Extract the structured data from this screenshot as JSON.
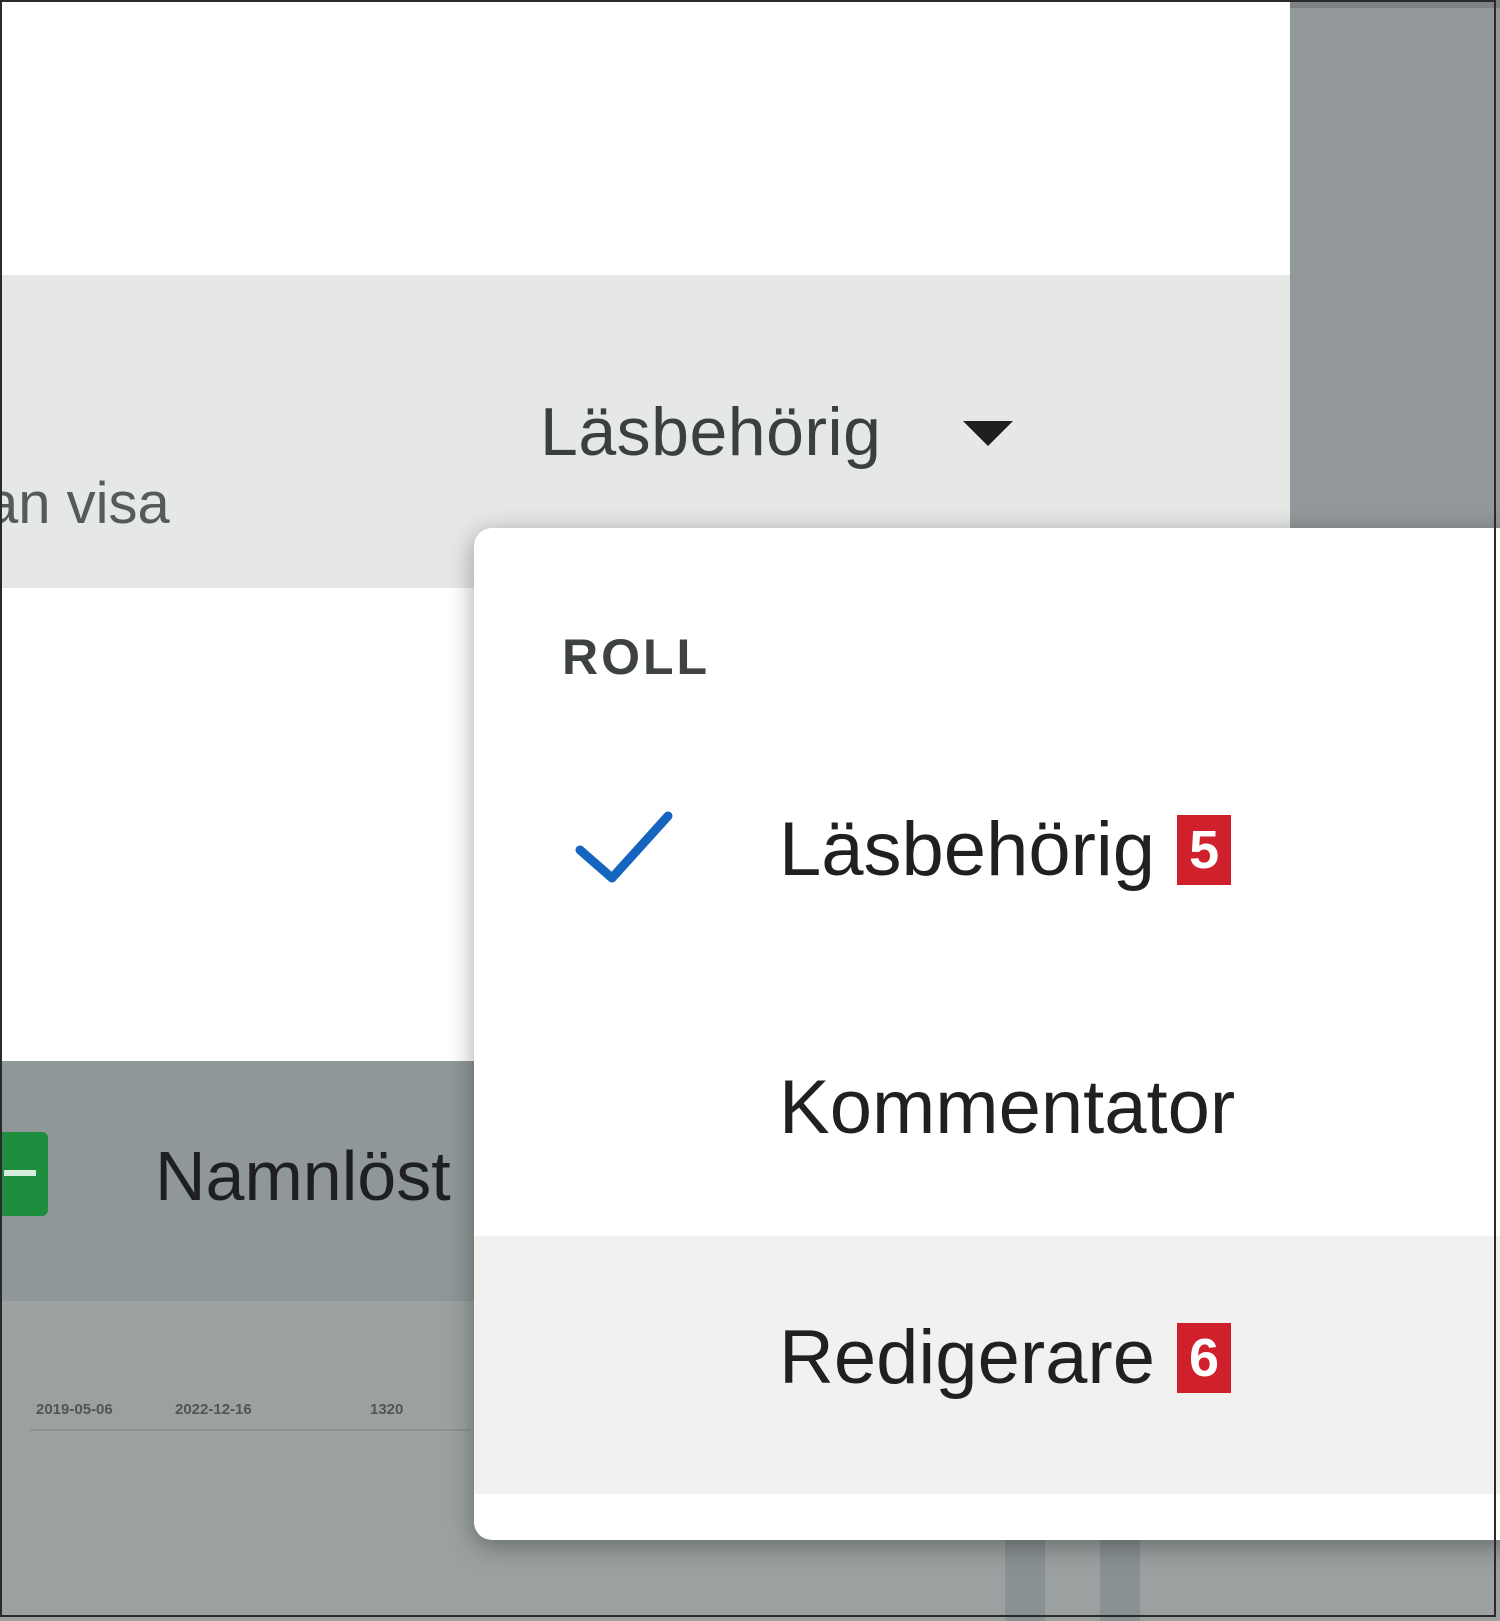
{
  "access": {
    "description_fragment": "an visa",
    "selected_role": "Läsbehörig"
  },
  "menu": {
    "heading": "ROLL",
    "items": [
      {
        "label": "Läsbehörig",
        "badge": "5",
        "checked": true
      },
      {
        "label": "Kommentator",
        "badge": "",
        "checked": false
      },
      {
        "label": "Redigerare",
        "badge": "6",
        "checked": false,
        "hovered": true
      }
    ]
  },
  "background_sheet": {
    "title": "Namnlöst",
    "list_cells": [
      "2019-05-06",
      "2022-12-16",
      "1320"
    ]
  },
  "colors": {
    "check": "#1565c0",
    "badge": "#d0202b",
    "sheets_icon": "#1e8e3e"
  },
  "icons": [
    "caret-down-icon",
    "check-icon",
    "sheets-icon"
  ]
}
